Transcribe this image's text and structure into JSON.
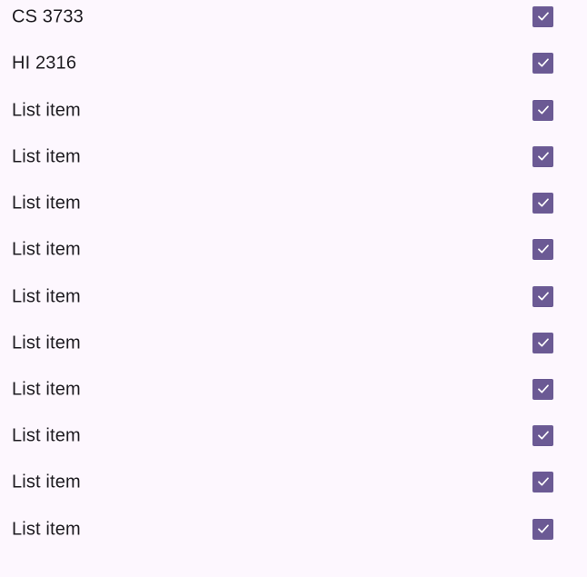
{
  "colors": {
    "background": "#fdf7fe",
    "checkbox_fill": "#6b5a94",
    "check_mark": "#ffffff",
    "text": "#1d1b20"
  },
  "list": {
    "items": [
      {
        "label": "CS 3733",
        "checked": true,
        "icon": "check-icon"
      },
      {
        "label": "HI 2316",
        "checked": true,
        "icon": "check-icon"
      },
      {
        "label": "List item",
        "checked": true,
        "icon": "check-icon"
      },
      {
        "label": "List item",
        "checked": true,
        "icon": "check-icon"
      },
      {
        "label": "List item",
        "checked": true,
        "icon": "check-icon"
      },
      {
        "label": "List item",
        "checked": true,
        "icon": "check-icon"
      },
      {
        "label": "List item",
        "checked": true,
        "icon": "check-icon"
      },
      {
        "label": "List item",
        "checked": true,
        "icon": "check-icon"
      },
      {
        "label": "List item",
        "checked": true,
        "icon": "check-icon"
      },
      {
        "label": "List item",
        "checked": true,
        "icon": "check-icon"
      },
      {
        "label": "List item",
        "checked": true,
        "icon": "check-icon"
      },
      {
        "label": "List item",
        "checked": true,
        "icon": "check-icon"
      }
    ]
  }
}
